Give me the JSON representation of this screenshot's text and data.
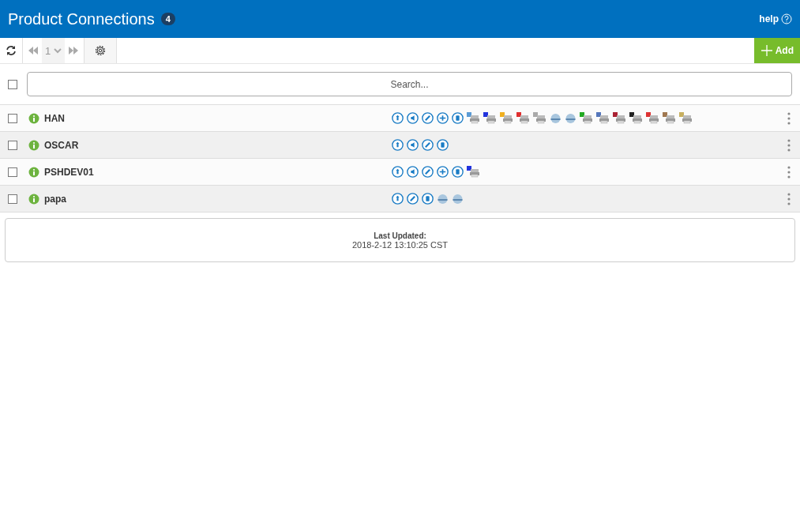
{
  "header": {
    "title": "Product Connections",
    "count": "4",
    "help": "help"
  },
  "toolbar": {
    "page": "1",
    "add": "Add"
  },
  "search": {
    "placeholder": "Search...",
    "checked": false
  },
  "rows": [
    {
      "name": "HAN",
      "checked": false,
      "icons": [
        {
          "kind": "up"
        },
        {
          "kind": "speaker"
        },
        {
          "kind": "link"
        },
        {
          "kind": "cross"
        },
        {
          "kind": "device"
        },
        {
          "kind": "printer",
          "color": "#5b9bd5"
        },
        {
          "kind": "printer",
          "color": "#2233dd"
        },
        {
          "kind": "printer",
          "color": "#f0b020"
        },
        {
          "kind": "printer",
          "color": "#e03030"
        },
        {
          "kind": "printer",
          "color": "#aaaaaa"
        },
        {
          "kind": "drum"
        },
        {
          "kind": "drum"
        },
        {
          "kind": "printer",
          "color": "#22aa22"
        },
        {
          "kind": "printer",
          "color": "#5577bb"
        },
        {
          "kind": "printer",
          "color": "#aa2233"
        },
        {
          "kind": "printer",
          "color": "#222222"
        },
        {
          "kind": "printer",
          "color": "#dd3333"
        },
        {
          "kind": "printer",
          "color": "#a07850"
        },
        {
          "kind": "printer",
          "color": "#c8b060"
        }
      ]
    },
    {
      "name": "OSCAR",
      "checked": false,
      "icons": [
        {
          "kind": "up"
        },
        {
          "kind": "speaker"
        },
        {
          "kind": "link"
        },
        {
          "kind": "device"
        }
      ]
    },
    {
      "name": "PSHDEV01",
      "checked": false,
      "icons": [
        {
          "kind": "up"
        },
        {
          "kind": "speaker"
        },
        {
          "kind": "link"
        },
        {
          "kind": "cross"
        },
        {
          "kind": "device"
        },
        {
          "kind": "printer",
          "color": "#2233dd"
        }
      ]
    },
    {
      "name": "papa",
      "checked": false,
      "icons": [
        {
          "kind": "up"
        },
        {
          "kind": "link"
        },
        {
          "kind": "device"
        },
        {
          "kind": "drum"
        },
        {
          "kind": "drum"
        }
      ]
    }
  ],
  "footer": {
    "label": "Last Updated:",
    "value": "2018-2-12 13:10:25 CST"
  }
}
